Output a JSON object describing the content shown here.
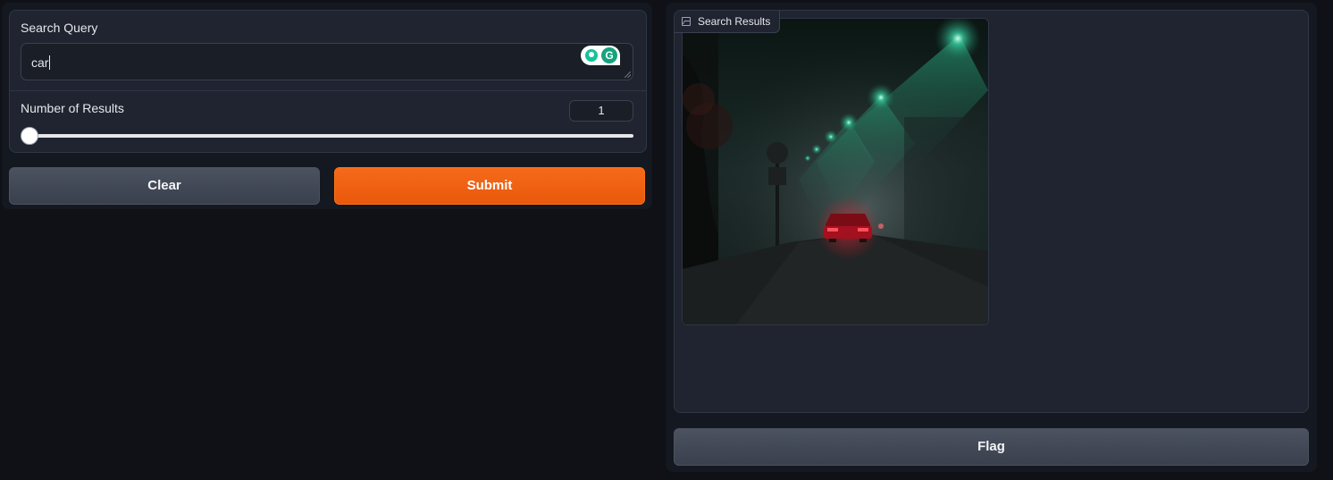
{
  "search": {
    "label": "Search Query",
    "value": "car"
  },
  "num_results": {
    "label": "Number of Results",
    "value": "1",
    "slider_fraction": 0.0
  },
  "buttons": {
    "clear": "Clear",
    "submit": "Submit",
    "flag": "Flag"
  },
  "results": {
    "label": "Search Results",
    "image_alt": "foggy street at night with car tail lights and green street lamps"
  },
  "icons": {
    "results_label_icon": "image-icon",
    "grammarly_icons": [
      "lightbulb-icon",
      "grammarly-icon"
    ]
  },
  "colors": {
    "accent": "#ea580c",
    "background": "#0f1117",
    "panel": "#1f2430"
  }
}
